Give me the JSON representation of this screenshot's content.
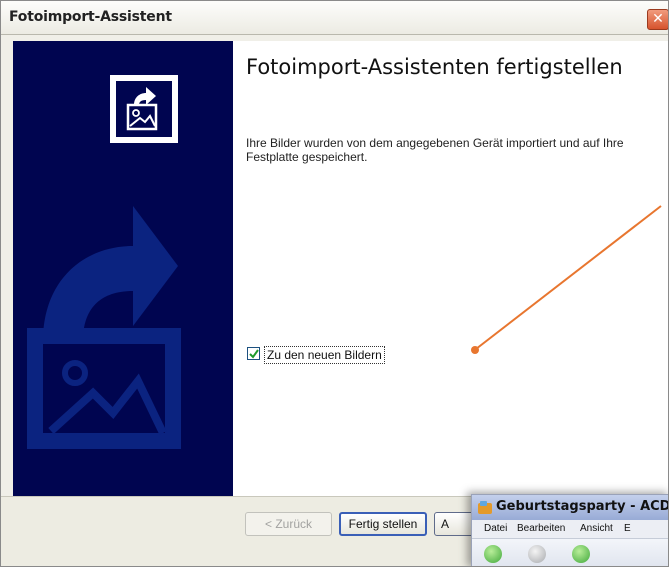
{
  "window": {
    "title": "Fotoimport-Assistent",
    "close_glyph": "✕"
  },
  "page": {
    "heading": "Fotoimport-Assistenten fertigstellen",
    "description": "Ihre Bilder wurden von dem angegebenen Gerät importiert und auf Ihre Festplatte gespeichert.",
    "checkbox": {
      "label": "Zu den neuen Bildern",
      "checked": true
    }
  },
  "buttons": {
    "back": "< Zurück",
    "finish": "Fertig stellen",
    "cancel": "A"
  },
  "popup": {
    "title": "Geburtstagsparty - ACDSee",
    "menu": [
      "Datei",
      "Bearbeiten",
      "Ansicht",
      "E"
    ]
  },
  "icons": {
    "wizard": "photo-import-icon",
    "side_art": "photo-arrow-illustration",
    "popup_app": "acdsee-icon"
  },
  "colors": {
    "side_panel": "#000550",
    "annotation_arrow": "#e8762f",
    "close_button": "#d6532d"
  }
}
